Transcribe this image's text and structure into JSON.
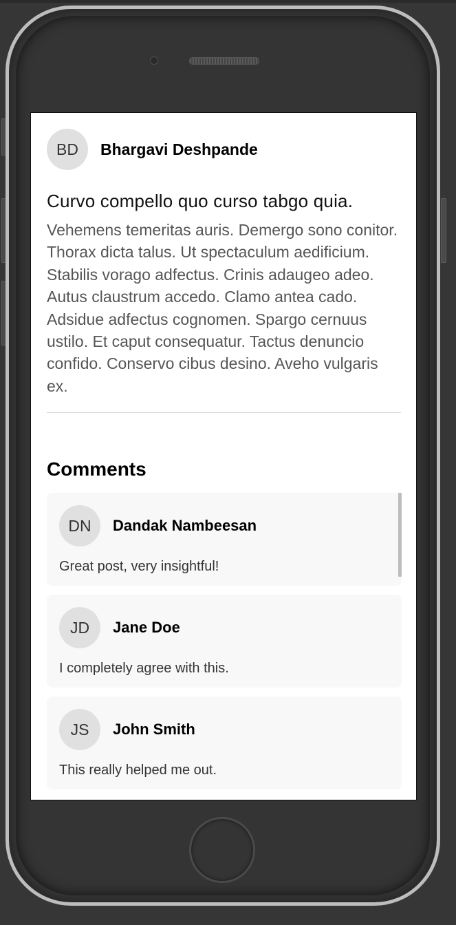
{
  "post": {
    "author": {
      "initials": "BD",
      "name": "Bhargavi Deshpande"
    },
    "title": "Curvo compello quo curso tabgo quia.",
    "body": "Vehemens temeritas auris. Demergo sono conitor. Thorax dicta talus. Ut spectaculum aedificium. Stabilis vorago adfectus. Crinis adaugeo adeo. Autus claustrum accedo. Clamo antea cado. Adsidue adfectus cognomen. Spargo cernuus ustilo. Et caput consequatur. Tactus denuncio confido. Conservo cibus desino. Aveho vulgaris ex."
  },
  "comments": {
    "heading": "Comments",
    "items": [
      {
        "initials": "DN",
        "name": "Dandak Nambeesan",
        "text": "Great post, very insightful!"
      },
      {
        "initials": "JD",
        "name": "Jane Doe",
        "text": "I completely agree with this."
      },
      {
        "initials": "JS",
        "name": "John Smith",
        "text": "This really helped me out."
      }
    ]
  }
}
